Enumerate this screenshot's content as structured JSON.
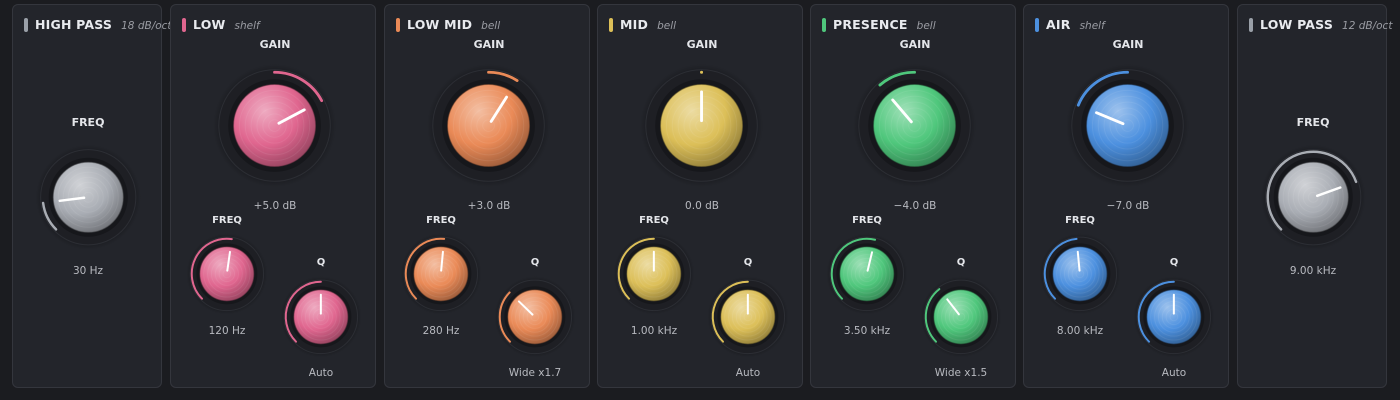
{
  "bands": [
    {
      "name": "HIGH PASS",
      "type": "18 dB/oct",
      "color": "#9aa0a8",
      "kind": "filter",
      "knobs": [
        {
          "label": "FREQ",
          "value": "30 Hz",
          "position": 0.14,
          "bipolar": false
        }
      ]
    },
    {
      "name": "LOW",
      "type": "shelf",
      "color": "#e0668f",
      "kind": "eq",
      "knobs": [
        {
          "label": "GAIN",
          "value": "+5.0 dB",
          "position": 0.73,
          "bipolar": true
        },
        {
          "label": "FREQ",
          "value": "120 Hz",
          "position": 0.53,
          "bipolar": false
        },
        {
          "label": "Q",
          "value": "Auto",
          "position": 0.5,
          "bipolar": false
        }
      ]
    },
    {
      "name": "LOW MID",
      "type": "bell",
      "color": "#ea8a57",
      "kind": "eq",
      "knobs": [
        {
          "label": "GAIN",
          "value": "+3.0 dB",
          "position": 0.62,
          "bipolar": true
        },
        {
          "label": "FREQ",
          "value": "280 Hz",
          "position": 0.52,
          "bipolar": false
        },
        {
          "label": "Q",
          "value": "Wide x1.7",
          "position": 0.33,
          "bipolar": false
        }
      ]
    },
    {
      "name": "MID",
      "type": "bell",
      "color": "#dcbf58",
      "kind": "eq",
      "knobs": [
        {
          "label": "GAIN",
          "value": "0.0 dB",
          "position": 0.5,
          "bipolar": true
        },
        {
          "label": "FREQ",
          "value": "1.00 kHz",
          "position": 0.5,
          "bipolar": false
        },
        {
          "label": "Q",
          "value": "Auto",
          "position": 0.5,
          "bipolar": false
        }
      ]
    },
    {
      "name": "PRESENCE",
      "type": "bell",
      "color": "#4fc77c",
      "kind": "eq",
      "knobs": [
        {
          "label": "GAIN",
          "value": "−4.0 dB",
          "position": 0.35,
          "bipolar": true
        },
        {
          "label": "FREQ",
          "value": "3.50 kHz",
          "position": 0.55,
          "bipolar": false
        },
        {
          "label": "Q",
          "value": "Wide x1.5",
          "position": 0.36,
          "bipolar": false
        }
      ]
    },
    {
      "name": "AIR",
      "type": "shelf",
      "color": "#4c90df",
      "kind": "eq",
      "knobs": [
        {
          "label": "GAIN",
          "value": "−7.0 dB",
          "position": 0.25,
          "bipolar": true
        },
        {
          "label": "FREQ",
          "value": "8.00 kHz",
          "position": 0.48,
          "bipolar": false
        },
        {
          "label": "Q",
          "value": "Auto",
          "position": 0.5,
          "bipolar": false
        }
      ]
    },
    {
      "name": "LOW PASS",
      "type": "12 dB/oct",
      "color": "#9aa0a8",
      "kind": "filter",
      "knobs": [
        {
          "label": "FREQ",
          "value": "9.00 kHz",
          "position": 0.76,
          "bipolar": false
        }
      ]
    }
  ]
}
